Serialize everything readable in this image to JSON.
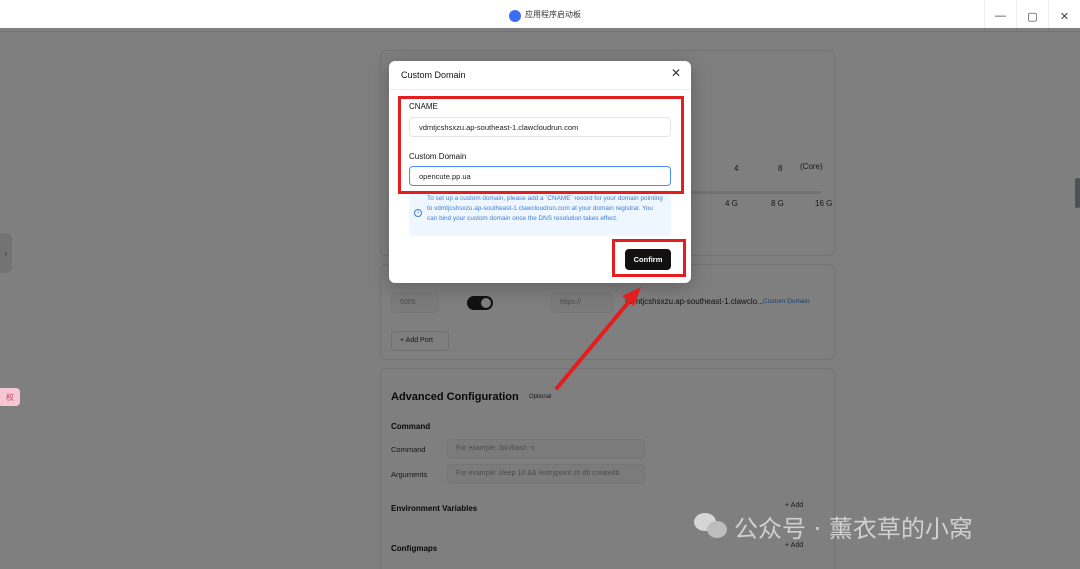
{
  "window": {
    "title": "应用程序启动板",
    "minimize_glyph": "—",
    "maximize_glyph": "▢",
    "close_glyph": "✕"
  },
  "background": {
    "cpu_ticks": [
      "4",
      "8"
    ],
    "cpu_unit": "(Core)",
    "mem_ticks": [
      "4 G",
      "8 G",
      "16 G"
    ],
    "port_value": "5005",
    "protocol": "https://",
    "domain_preview": "vdmtjcshsxzu.ap-southeast-1.clawclo...",
    "custom_domain_link": "Custom Domain",
    "add_port_label": "+ Add Port",
    "advanced_title": "Advanced Configuration",
    "optional_badge": "Optional",
    "command_section": "Command",
    "command_label": "Command",
    "command_placeholder": "For example: /bin/bash -c",
    "arguments_label": "Arguments",
    "arguments_placeholder": "For example: sleep 10 && /entrypoint.sh db createdb",
    "env_title": "Environment Variables",
    "env_add": "+ Add",
    "configmaps_title": "Configmaps",
    "configmaps_add": "+ Add",
    "side_tab_glyph": "›",
    "pink_badge": "权"
  },
  "modal": {
    "title": "Custom Domain",
    "close_glyph": "✕",
    "cname_label": "CNAME",
    "cname_value": "vdmtjcshsxzu.ap-southeast-1.clawcloudrun.com",
    "custom_domain_label": "Custom Domain",
    "custom_domain_value": "opencute.pp.ua",
    "info_text": "To set up a custom domain, please add a `CNAME` record for your domain pointing to vdmtjcshsxzu.ap-southeast-1.clawcloudrun.com at your domain registrar. You can bind your custom domain once the DNS resolution takes effect.",
    "info_icon": "i",
    "confirm_label": "Confirm"
  },
  "watermark": {
    "text": "公众号 · 薰衣草的小窝"
  },
  "colors": {
    "annotation_red": "#e41e1e",
    "info_blue": "#3f7fd6",
    "confirm_bg": "#111111"
  }
}
